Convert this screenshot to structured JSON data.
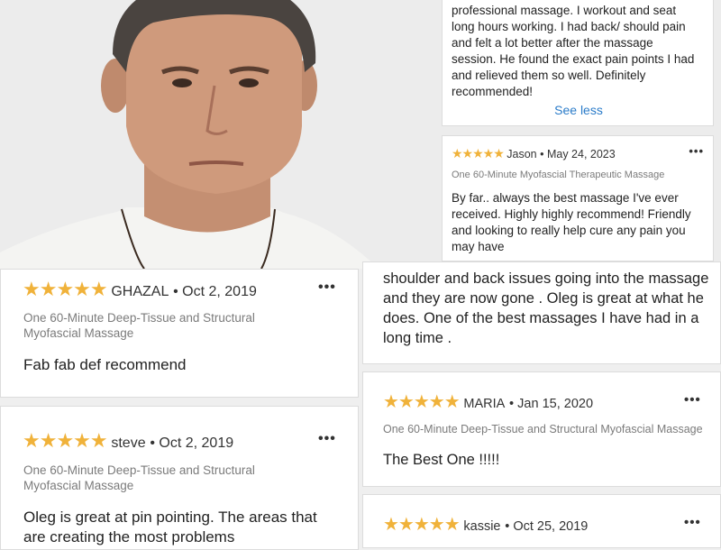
{
  "top_right": {
    "review1": {
      "text_lines": [
        "professional massage. I workout and seat",
        "long hours working. I had back/ should pain",
        "and felt a lot better after the massage",
        "session. He found the exact pain points I had",
        "and relieved them so well. Definitely",
        "recommended!"
      ],
      "see_less": "See less"
    },
    "review2": {
      "stars": "★★★★★",
      "name": "Jason",
      "date": "May 24, 2023",
      "service": "One 60-Minute Myofascial Therapeutic Massage",
      "text_lines": [
        "By far.. always the best massage I've ever",
        "received. Highly highly recommend! Friendly",
        "and looking to really help cure any pain you",
        "may have"
      ],
      "menu": "•••"
    }
  },
  "left_column": [
    {
      "stars": "★★★★★",
      "name": "GHAZAL",
      "date": "Oct 2, 2019",
      "service_lines": [
        "One 60-Minute Deep-Tissue and Structural",
        "Myofascial Massage"
      ],
      "text_lines": [
        "Fab fab def recommend"
      ],
      "menu": "•••"
    },
    {
      "stars": "★★★★★",
      "name": "steve",
      "date": "Oct 2, 2019",
      "service_lines": [
        "One 60-Minute Deep-Tissue and Structural",
        "Myofascial Massage"
      ],
      "text_lines": [
        "Oleg is great at pin pointing. The areas that",
        "are creating the most problems"
      ],
      "menu": "•••"
    }
  ],
  "right_column": {
    "continued_text_lines": [
      "shoulder and back issues going into the massage",
      "and they are now gone . Oleg is great at what he",
      "does. One of the best massages I have had in a",
      "long time ."
    ],
    "reviews": [
      {
        "stars": "★★★★★",
        "name": "MARIA",
        "date": "Jan 15, 2020",
        "service": "One 60-Minute Deep-Tissue and Structural Myofascial Massage",
        "text": "The Best One !!!!!",
        "menu": "•••"
      },
      {
        "stars": "★★★★★",
        "name": "kassie",
        "date": "Oct 25, 2019",
        "menu": "•••"
      }
    ]
  }
}
